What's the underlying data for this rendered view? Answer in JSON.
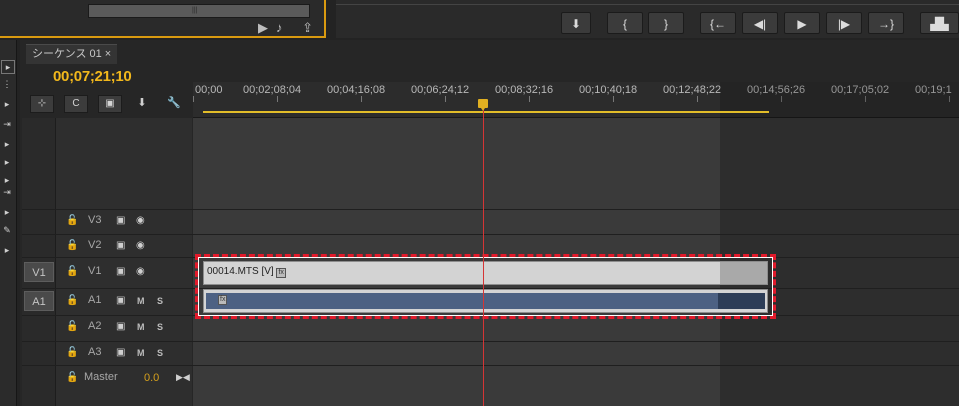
{
  "top_bar": {
    "grip_glyph": "|||",
    "left_icons": [
      {
        "icon": "insert-audio-icon",
        "glyph": "▶♪"
      },
      {
        "icon": "export-frame-icon",
        "glyph": "⇪"
      }
    ],
    "transport_buttons": [
      {
        "icon": "add-marker-icon",
        "glyph": "⬇"
      },
      {
        "icon": "mark-in-icon",
        "glyph": "{"
      },
      {
        "icon": "mark-out-icon",
        "glyph": "}"
      },
      {
        "icon": "go-to-in-icon",
        "glyph": "{←"
      },
      {
        "icon": "step-back-icon",
        "glyph": "◀|"
      },
      {
        "icon": "play-icon",
        "glyph": "▶"
      },
      {
        "icon": "step-forward-icon",
        "glyph": "|▶"
      },
      {
        "icon": "go-to-out-icon",
        "glyph": "→}"
      },
      {
        "icon": "button-editor-icon",
        "glyph": "▟▙"
      }
    ]
  },
  "tools": [
    "▸",
    "⋮",
    "▸",
    "⇥",
    "▸",
    "▸",
    "▸",
    "⇥",
    "▸",
    "✎",
    "▸"
  ],
  "timeline": {
    "tab_label": "シーケンス 01 ×",
    "timecode": "00;07;21;10",
    "controls": [
      {
        "icon": "snap-icon",
        "glyph": "⊹"
      },
      {
        "icon": "linked-selection-icon",
        "glyph": "C"
      },
      {
        "icon": "add-marker-icon",
        "glyph": "▣"
      },
      {
        "icon": "marker-icon",
        "glyph": "⬇"
      },
      {
        "icon": "wrench-icon",
        "glyph": "🔧"
      }
    ],
    "ruler_ticks": [
      "00;00",
      "00;02;08;04",
      "00;04;16;08",
      "00;06;24;12",
      "00;08;32;16",
      "00;10;40;18",
      "00;12;48;22",
      "00;14;56;26",
      "00;17;05;02",
      "00;19;1"
    ],
    "tracks": {
      "v3": {
        "name": "V3"
      },
      "v2": {
        "name": "V2"
      },
      "v1": {
        "name": "V1",
        "source": "V1"
      },
      "a1": {
        "name": "A1",
        "source": "A1",
        "m": "M",
        "s": "S"
      },
      "a2": {
        "name": "A2",
        "m": "M",
        "s": "S"
      },
      "a3": {
        "name": "A3",
        "m": "M",
        "s": "S"
      },
      "master": {
        "name": "Master",
        "value": "0.0"
      }
    },
    "icons": {
      "lock_glyph": "🔓",
      "film_glyph": "▣",
      "eye_glyph": "◉",
      "master_end_glyph": "▶◀"
    },
    "clips": {
      "video_label": "00014.MTS [V]",
      "fx": "fx"
    }
  }
}
